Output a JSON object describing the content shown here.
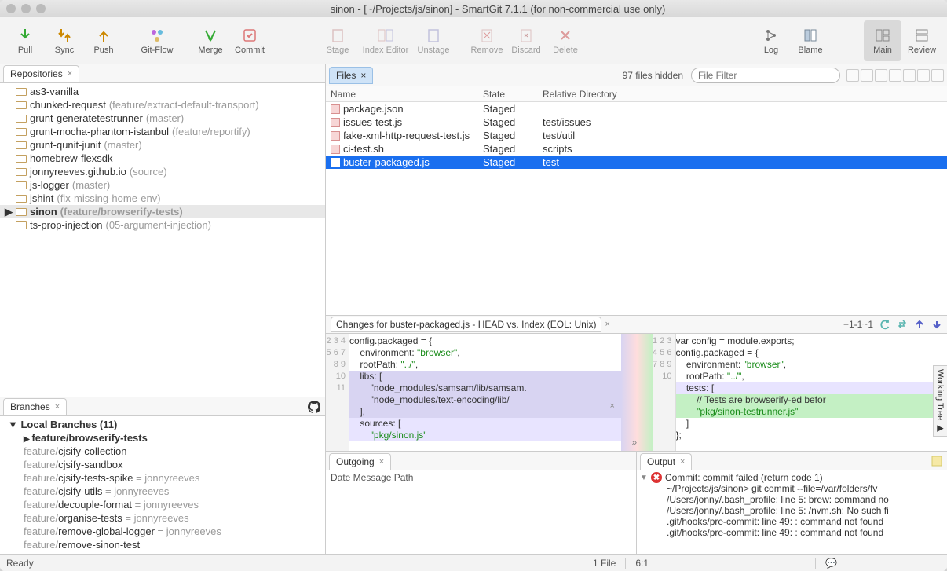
{
  "window": {
    "title": "sinon - [~/Projects/js/sinon] - SmartGit 7.1.1 (for non-commercial use only)"
  },
  "toolbar": {
    "pull": "Pull",
    "sync": "Sync",
    "push": "Push",
    "gitflow": "Git-Flow",
    "merge": "Merge",
    "commit": "Commit",
    "stage": "Stage",
    "indexeditor": "Index Editor",
    "unstage": "Unstage",
    "remove": "Remove",
    "discard": "Discard",
    "delete": "Delete",
    "log": "Log",
    "blame": "Blame",
    "main": "Main",
    "review": "Review"
  },
  "repos": {
    "tab": "Repositories",
    "items": [
      {
        "name": "as3-vanilla",
        "branch": ""
      },
      {
        "name": "chunked-request",
        "branch": "(feature/extract-default-transport)"
      },
      {
        "name": "grunt-generatetestrunner",
        "branch": "(master)"
      },
      {
        "name": "grunt-mocha-phantom-istanbul",
        "branch": "(feature/reportify)"
      },
      {
        "name": "grunt-qunit-junit",
        "branch": "(master)"
      },
      {
        "name": "homebrew-flexsdk",
        "branch": ""
      },
      {
        "name": "jonnyreeves.github.io",
        "branch": "(source)"
      },
      {
        "name": "js-logger",
        "branch": "(master)"
      },
      {
        "name": "jshint",
        "branch": "(fix-missing-home-env)"
      },
      {
        "name": "sinon",
        "branch": "(feature/browserify-tests)",
        "selected": true
      },
      {
        "name": "ts-prop-injection",
        "branch": "(05-argument-injection)"
      }
    ]
  },
  "branches": {
    "tab": "Branches",
    "group": "Local Branches (11)",
    "items": [
      {
        "prefix": "",
        "name": "feature/browserify-tests",
        "suffix": "",
        "current": true
      },
      {
        "prefix": "feature/",
        "name": "cjsify-collection",
        "suffix": ""
      },
      {
        "prefix": "feature/",
        "name": "cjsify-sandbox",
        "suffix": ""
      },
      {
        "prefix": "feature/",
        "name": "cjsify-tests-spike",
        "suffix": " = jonnyreeves"
      },
      {
        "prefix": "feature/",
        "name": "cjsify-utils",
        "suffix": " = jonnyreeves"
      },
      {
        "prefix": "feature/",
        "name": "decouple-format",
        "suffix": " = jonnyreeves"
      },
      {
        "prefix": "feature/",
        "name": "organise-tests",
        "suffix": " = jonnyreeves"
      },
      {
        "prefix": "feature/",
        "name": "remove-global-logger",
        "suffix": " = jonnyreeves"
      },
      {
        "prefix": "feature/",
        "name": "remove-sinon-test",
        "suffix": ""
      }
    ]
  },
  "files": {
    "tab": "Files",
    "hidden": "97 files hidden",
    "filter_placeholder": "File Filter",
    "cols": {
      "name": "Name",
      "state": "State",
      "dir": "Relative Directory"
    },
    "rows": [
      {
        "name": "package.json",
        "state": "Staged",
        "dir": ""
      },
      {
        "name": "issues-test.js",
        "state": "Staged",
        "dir": "test/issues"
      },
      {
        "name": "fake-xml-http-request-test.js",
        "state": "Staged",
        "dir": "test/util"
      },
      {
        "name": "ci-test.sh",
        "state": "Staged",
        "dir": "scripts"
      },
      {
        "name": "buster-packaged.js",
        "state": "Staged",
        "dir": "test",
        "selected": true
      }
    ]
  },
  "changes": {
    "title": "Changes for buster-packaged.js - HEAD vs. Index (EOL: Unix)",
    "summary": "+1-1~1",
    "left": [
      "",
      "config.packaged = {",
      "    environment: \"browser\",",
      "    rootPath: \"../\",",
      "    libs: [",
      "        \"node_modules/samsam/lib/samsam.",
      "        \"node_modules/text-encoding/lib/",
      "    ],",
      "    sources: [",
      "        \"pkg/sinon.js\""
    ],
    "left_start": 2,
    "right": [
      "var config = module.exports;",
      "",
      "config.packaged = {",
      "    environment: \"browser\",",
      "    rootPath: \"../\",",
      "    tests: [",
      "        // Tests are browserify-ed befor",
      "        \"pkg/sinon-testrunner.js\"",
      "    ]",
      "};"
    ],
    "right_start": 1,
    "wt_label": "Working Tree"
  },
  "outgoing": {
    "tab": "Outgoing",
    "header": "Date Message Path"
  },
  "output": {
    "tab": "Output",
    "title": "Commit: commit failed (return code 1)",
    "lines": [
      "~/Projects/js/sinon> git commit --file=/var/folders/fv",
      "/Users/jonny/.bash_profile: line 5: brew: command no",
      "/Users/jonny/.bash_profile: line 5: /nvm.sh: No such fi",
      ".git/hooks/pre-commit: line 49: : command not found",
      ".git/hooks/pre-commit: line 49: : command not found"
    ]
  },
  "status": {
    "ready": "Ready",
    "filecount": "1 File",
    "pos": "6:1"
  }
}
